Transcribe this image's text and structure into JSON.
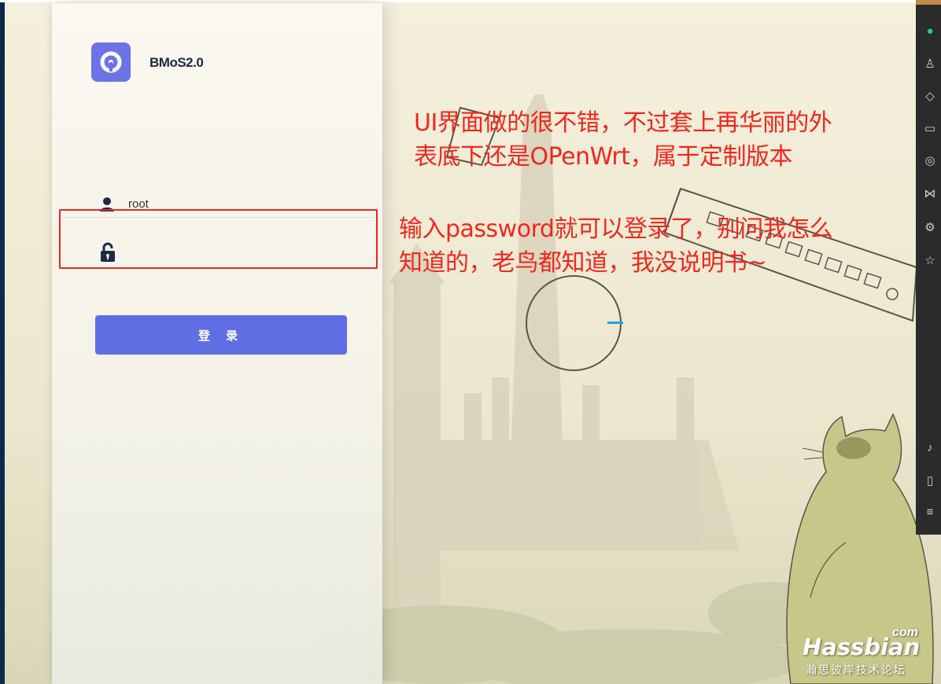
{
  "brand": {
    "name": "BMoS2.0"
  },
  "login": {
    "username_value": "root",
    "password_value": "",
    "submit_label": "登 录"
  },
  "annotations": {
    "note1_line1": "UI界面做的很不错，不过套上再华丽的外",
    "note1_line2": "表底下还是OPenWrt，属于定制版本",
    "note2_line1": "输入password就可以登录了，别问我怎么",
    "note2_line2": "知道的，老鸟都知道，我没说明书~"
  },
  "watermark": {
    "main": "Hassbian",
    "suffix": "com",
    "subtitle": "瀚思彼岸技术论坛"
  },
  "colors": {
    "accent": "#5f6ee3",
    "logo": "#6b73e6",
    "annotation": "#f0271e",
    "loader_tick": "#1fa1e6"
  },
  "icons": [
    "user-icon",
    "unlock-icon",
    "logo-icon",
    "chat-icon",
    "contacts-icon",
    "cube-icon",
    "folder-icon",
    "aperture-icon",
    "butterfly-icon",
    "gear-icon",
    "star-icon",
    "music-icon",
    "phone-icon",
    "menu-icon"
  ]
}
